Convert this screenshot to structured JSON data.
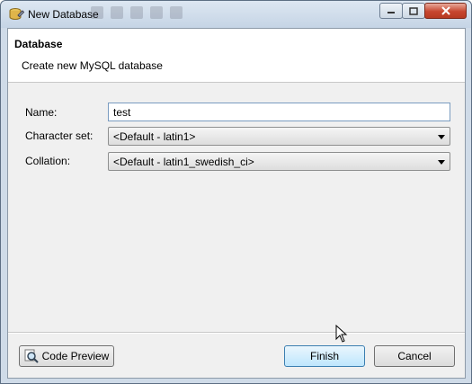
{
  "window": {
    "title": "New Database",
    "app_icon": "database-wizard-icon",
    "controls": {
      "minimize": "minimize-icon",
      "maximize": "maximize-icon",
      "close": "close-icon"
    }
  },
  "header": {
    "title": "Database",
    "description": "Create new MySQL database"
  },
  "form": {
    "name_label": "Name:",
    "name_value": "test",
    "charset_label": "Character set:",
    "charset_value": "<Default - latin1>",
    "collation_label": "Collation:",
    "collation_value": "<Default - latin1_swedish_ci>"
  },
  "buttons": {
    "code_preview": "Code Preview",
    "code_preview_icon": "magnifier-icon",
    "finish": "Finish",
    "cancel": "Cancel"
  },
  "colors": {
    "dialog_bg": "#f0f0f0",
    "header_bg": "#ffffff",
    "primary_button": "#bee6fd",
    "close_button": "#c7462f"
  }
}
